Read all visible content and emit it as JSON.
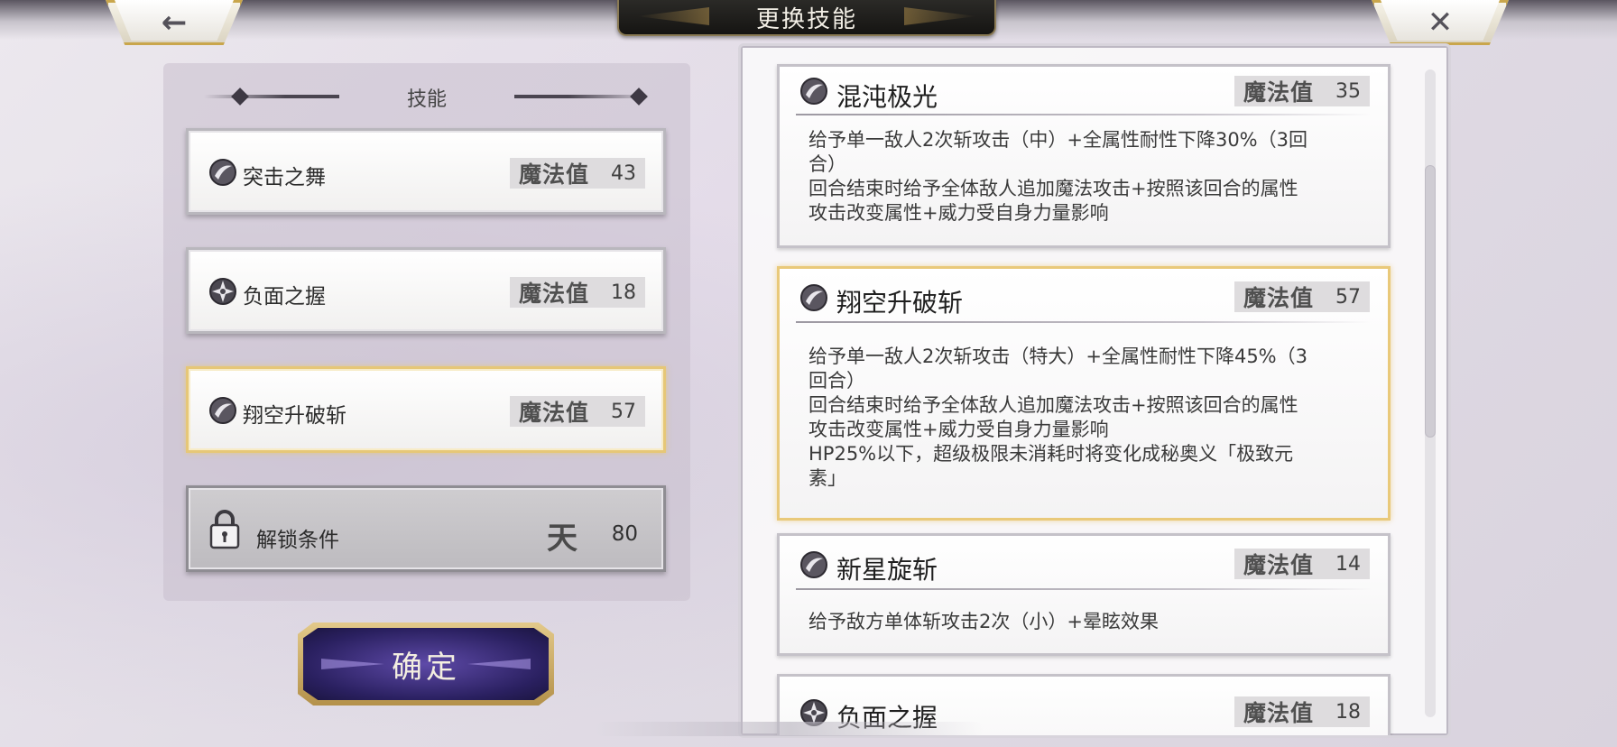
{
  "header": {
    "title": "更换技能",
    "back_glyph": "←",
    "close_glyph": "✕"
  },
  "left_panel": {
    "heading": "技能",
    "slots": [
      {
        "icon": "blade-orb-icon",
        "name": "突击之舞",
        "mp_label": "魔法值",
        "mp_value": "43"
      },
      {
        "icon": "shuriken-orb-icon",
        "name": "负面之握",
        "mp_label": "魔法值",
        "mp_value": "18"
      },
      {
        "icon": "blade-orb-icon",
        "name": "翔空升破斩",
        "mp_label": "魔法值",
        "mp_value": "57"
      }
    ],
    "locked_slot": {
      "icon": "lock-icon",
      "name": "解锁条件",
      "rank_glyph": "天",
      "value": "80"
    }
  },
  "confirm_button": {
    "label": "确定"
  },
  "skill_list": [
    {
      "icon": "blade-orb-icon",
      "name": "混沌极光",
      "mp_label": "魔法值",
      "mp_value": "35",
      "desc": [
        "给予单一敌人2次斩攻击（中）+全属性耐性下降30%（3回",
        "合）",
        "回合结束时给予全体敌人追加魔法攻击+按照该回合的属性",
        "攻击改变属性+威力受自身力量影响"
      ]
    },
    {
      "icon": "blade-orb-icon",
      "name": "翔空升破斩",
      "mp_label": "魔法值",
      "mp_value": "57",
      "desc": [
        "给予单一敌人2次斩攻击（特大）+全属性耐性下降45%（3",
        "回合）",
        "回合结束时给予全体敌人追加魔法攻击+按照该回合的属性",
        "攻击改变属性+威力受自身力量影响",
        "HP25%以下，超级极限未消耗时将变化成秘奥义「极致元",
        "素」"
      ]
    },
    {
      "icon": "blade-orb-icon",
      "name": "新星旋斩",
      "mp_label": "魔法值",
      "mp_value": "14",
      "desc": [
        "给予敌方单体斩攻击2次（小）+晕眩效果"
      ]
    },
    {
      "icon": "shuriken-orb-icon",
      "name": "负面之握",
      "mp_label": "魔法值",
      "mp_value": "18",
      "desc": []
    }
  ],
  "colors": {
    "selected_border": "#e9c97a",
    "gold_frame": "#c9a64c",
    "confirm_fill": "#2a2060"
  }
}
